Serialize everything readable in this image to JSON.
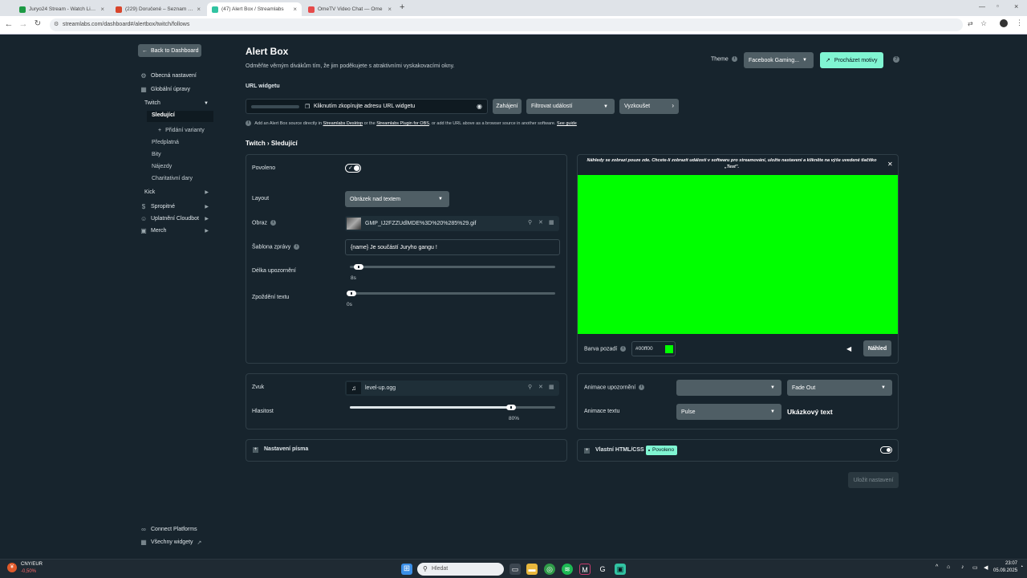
{
  "browser": {
    "tabs": [
      {
        "title": "Juryo24 Stream - Watch Live o",
        "color": "#1d9a44",
        "active": false
      },
      {
        "title": "(229) Doručené – Seznam Email",
        "color": "#d8452b",
        "active": false
      },
      {
        "title": "(47) Alert Box / Streamlabs",
        "color": "#31c3a2",
        "active": true
      },
      {
        "title": "OmeTV Video Chat — Ome",
        "color": "#e64a4a",
        "active": false
      }
    ],
    "url": "streamlabs.com/dashboard#/alertbox/twitch/follows"
  },
  "sidebar": {
    "back_label": "Back to Dashboard",
    "obecna": "Obecná nastavení",
    "globalni": "Globální úpravy",
    "twitch": "Twitch",
    "sledujici": "Sledující",
    "pridani": "Přidání varianty",
    "predplatna": "Předplatná",
    "bity": "Bity",
    "najezdy": "Nájezdy",
    "charita": "Charitativní dary",
    "kick": "Kick",
    "spropitne": "Spropitné",
    "cloudbot": "Uplatnění Cloudbot",
    "merch": "Merch",
    "connect": "Connect Platforms",
    "vsechny": "Všechny widgety"
  },
  "header": {
    "title": "Alert Box",
    "subtitle": "Odměňte věrným divákům tím, že jim poděkujete s atraktivními vyskakovacími okny.",
    "theme_label": "Theme",
    "theme_value": "Facebook Gaming...",
    "browse_label": "Procházet motivy"
  },
  "widget_url": {
    "label": "URL widgetu",
    "copy_label": "Kliknutím zkopírujte adresu URL widgetu",
    "launch_label": "Zahájení",
    "filter_label": "Filtrovat událostí",
    "try_label": "Vyzkoušet",
    "note_1": "Add an Alert Box source directly in",
    "note_link_1": "Streamlabs Desktop",
    "note_2": "or the",
    "note_link_2": "Streamlabs Plugin for OBS",
    "note_3": ", or add the URL above as a browser source in another software.",
    "note_link_3": "See guide"
  },
  "breadcrumb": "Twitch › Sledující",
  "settings": {
    "enabled_label": "Povoleno",
    "layout_label": "Layout",
    "layout_value": "Obrázek nad textem",
    "image_label": "Obraz",
    "image_value": "GMP_IJ2FZZUdlMDE%3D%20%285%29.gif",
    "template_label": "Šablona zprávy",
    "template_value": "{name} Je součástí Juryho gangu !",
    "duration_label": "Délka upozornění",
    "duration_value": "8s",
    "duration_fraction": 0.02,
    "delay_label": "Zpoždění textu",
    "delay_value": "0s",
    "delay_fraction": 0.0
  },
  "preview": {
    "notice": "Náhledy se zobrazí pouze zde. Chcete-li zobrazit události v softwaru pro streamování, uložte nastavení a klikněte na výše uvedené tlačítko „Test\".",
    "screen_color": "#00ff00",
    "bg_label": "Barva pozadí",
    "bg_value": "#00ff00",
    "preview_btn": "Náhled"
  },
  "sound": {
    "sound_label": "Zvuk",
    "sound_value": "level-up.ogg",
    "volume_label": "Hlasitost",
    "volume_value": "80%",
    "volume_fraction": 0.8
  },
  "animation": {
    "alert_label": "Animace upozornění",
    "alert_in": "",
    "alert_out": "Fade Out",
    "text_label": "Animace textu",
    "text_value": "Pulse",
    "sample": "Ukázkový text"
  },
  "font_section": "Nastavení písma",
  "custom_css": {
    "label": "Vlastní HTML/CSS",
    "badge": "Povoleno"
  },
  "save_label": "Uložit nastavení",
  "taskbar": {
    "widget_pair": "CNY/EUR",
    "widget_change": "-0,50%",
    "search_placeholder": "Hledat",
    "time": "23:07",
    "date": "05.09.2025"
  }
}
